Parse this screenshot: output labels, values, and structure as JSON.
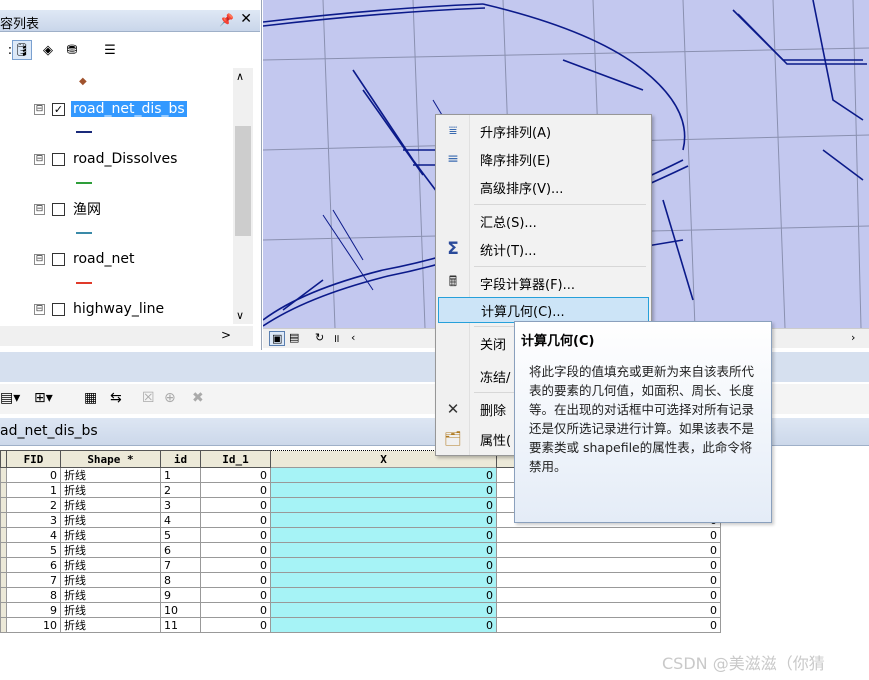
{
  "toc": {
    "title": "容列表",
    "pin": "ᅟ",
    "close": "✕",
    "layers": [
      {
        "name": "road_net_dis_bs",
        "checked": "✓",
        "selected": true,
        "color": "#1a2a7a"
      },
      {
        "name": "road_Dissolves",
        "checked": "",
        "selected": false,
        "color": "#2e9e3a"
      },
      {
        "name": "渔网",
        "checked": "",
        "selected": false,
        "color": "#3a8aa8"
      },
      {
        "name": "road_net",
        "checked": "",
        "selected": false,
        "color": "#e03a2a"
      },
      {
        "name": "highway_line",
        "checked": "",
        "selected": false,
        "color": "#333333"
      }
    ],
    "expander": "⊟"
  },
  "context_menu": {
    "items": [
      {
        "label": "升序排列(A)",
        "icon": "sort-ascending-icon"
      },
      {
        "label": "降序排列(E)",
        "icon": "sort-descending-icon"
      },
      {
        "label": "高级排序(V)...",
        "icon": ""
      },
      {
        "label": "汇总(S)...",
        "icon": ""
      },
      {
        "label": "统计(T)...",
        "icon": "sigma-icon"
      },
      {
        "label": "字段计算器(F)...",
        "icon": "calculator-icon"
      },
      {
        "label": "计算几何(C)...",
        "icon": "",
        "highlighted": true
      },
      {
        "label": "关闭",
        "icon": ""
      },
      {
        "label": "冻结/",
        "icon": ""
      },
      {
        "label": "删除",
        "icon": "delete-icon"
      },
      {
        "label": "属性(",
        "icon": "properties-icon"
      }
    ]
  },
  "tooltip": {
    "title": "计算几何(C)",
    "body": "将此字段的值填充或更新为来自该表所代表的要素的几何值，如面积、周长、长度等。在出现的对话框中可选择对所有记录还是仅所选记录进行计算。如果该表不是要素类或 shapefile的属性表，此命令将禁用。"
  },
  "table": {
    "tab_title": "ad_net_dis_bs",
    "headers": [
      "FID",
      "Shape *",
      "id",
      "Id_1",
      "X",
      ""
    ],
    "rows": [
      [
        "0",
        "折线",
        "1",
        "0",
        "0",
        ""
      ],
      [
        "1",
        "折线",
        "2",
        "0",
        "0",
        ""
      ],
      [
        "2",
        "折线",
        "3",
        "0",
        "0",
        ""
      ],
      [
        "3",
        "折线",
        "4",
        "0",
        "0",
        "0"
      ],
      [
        "4",
        "折线",
        "5",
        "0",
        "0",
        "0"
      ],
      [
        "5",
        "折线",
        "6",
        "0",
        "0",
        "0"
      ],
      [
        "6",
        "折线",
        "7",
        "0",
        "0",
        "0"
      ],
      [
        "7",
        "折线",
        "8",
        "0",
        "0",
        "0"
      ],
      [
        "8",
        "折线",
        "9",
        "0",
        "0",
        "0"
      ],
      [
        "9",
        "折线",
        "10",
        "0",
        "0",
        "0"
      ],
      [
        "10",
        "折线",
        "11",
        "0",
        "0",
        "0"
      ]
    ]
  },
  "watermark": "CSDN @美滋滋（你猜",
  "colors": {
    "map_bg": "#c3c8ef",
    "road": "#0b1a8a",
    "grid": "#8a90b0",
    "x_column": "#a6f3f6",
    "selection": "#3399ff"
  }
}
